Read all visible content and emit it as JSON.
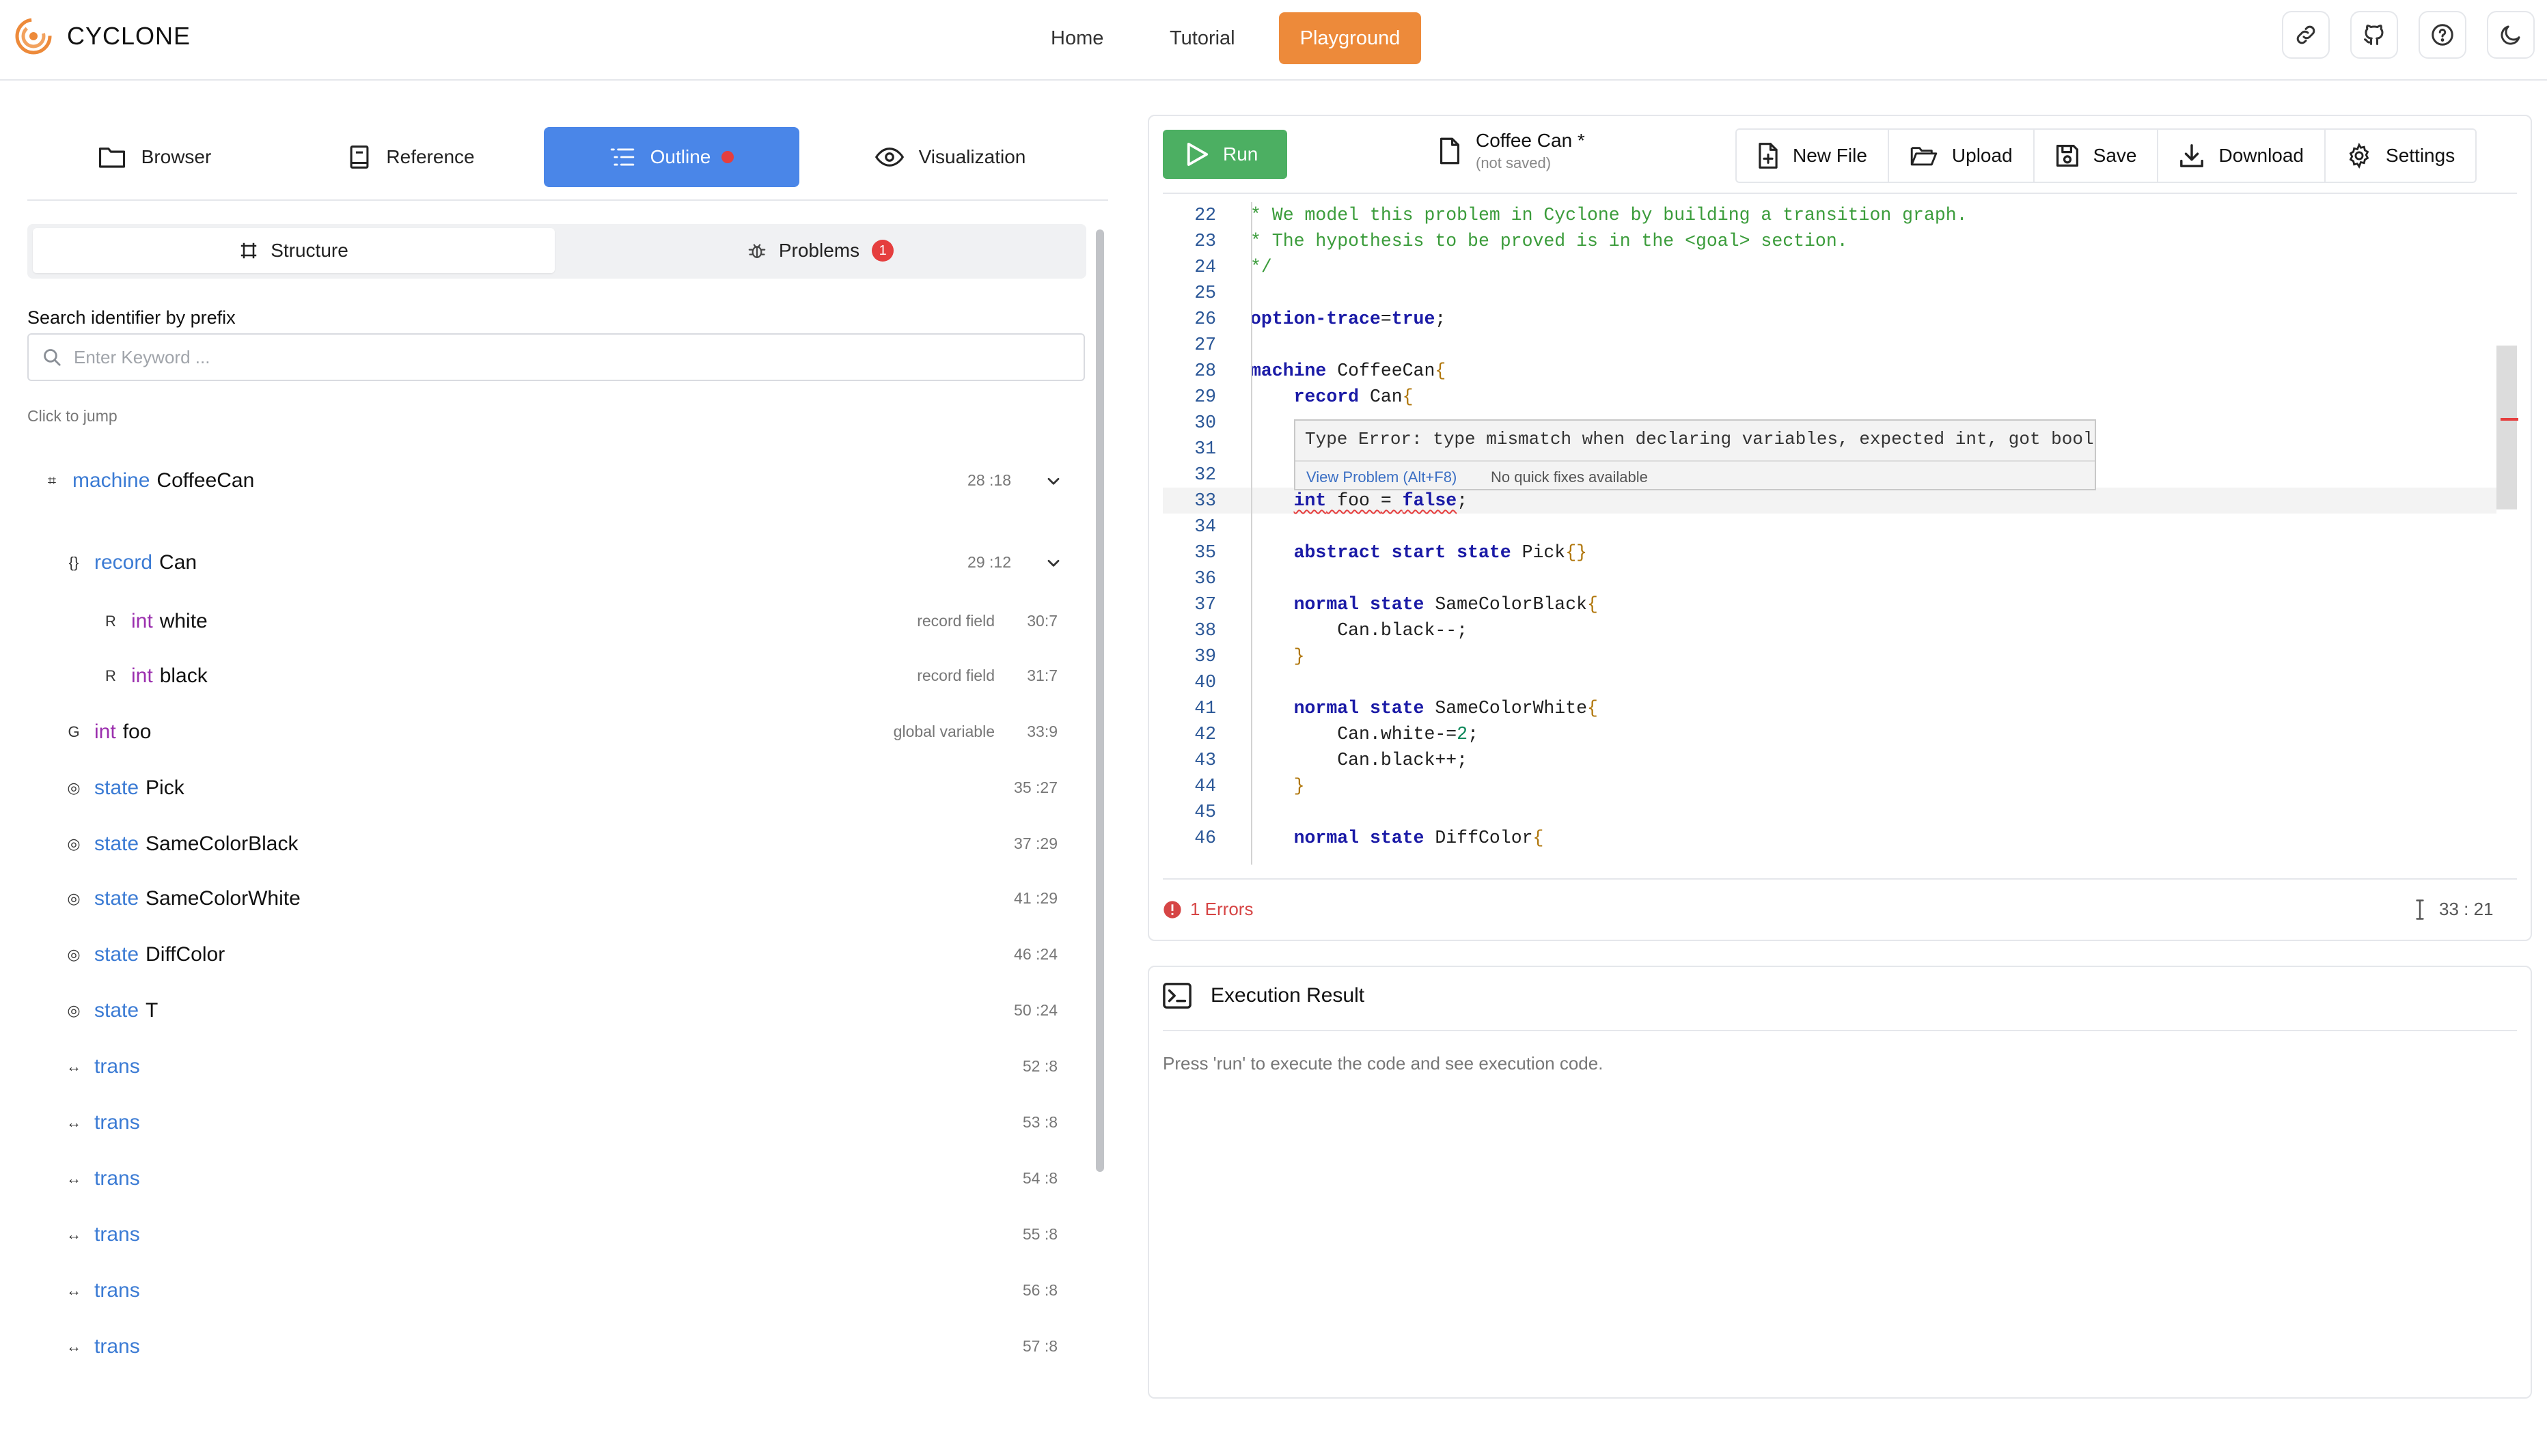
{
  "header": {
    "brand": "CYCLONE",
    "nav": [
      "Home",
      "Tutorial",
      "Playground"
    ],
    "icons": [
      "link-icon",
      "github-icon",
      "help-icon",
      "moon-icon"
    ]
  },
  "colors": {
    "accent": "#ed8a3a",
    "tab_active": "#4a86e8",
    "run": "#4caf62",
    "error": "#e53e3e"
  },
  "left": {
    "tabs": [
      "Browser",
      "Reference",
      "Outline",
      "Visualization"
    ],
    "active_tab": "Outline",
    "subtabs": {
      "structure": "Structure",
      "problems": "Problems",
      "problems_count": "1"
    },
    "search": {
      "label": "Search identifier by prefix",
      "placeholder": "Enter Keyword ..."
    },
    "hint": "Click to jump",
    "outline": [
      {
        "icon": "⌗",
        "kw": "machine",
        "name": "CoffeeCan",
        "kind": "",
        "pos": "28 :18",
        "expand": true
      },
      {
        "icon": "{}",
        "kw": "record",
        "name": "Can",
        "kind": "",
        "pos": "29 :12",
        "expand": true
      },
      {
        "icon": "R",
        "kw": "int",
        "name": "white",
        "kind": "record field",
        "pos": "30:7"
      },
      {
        "icon": "R",
        "kw": "int",
        "name": "black",
        "kind": "record field",
        "pos": "31:7"
      },
      {
        "icon": "G",
        "kw": "int",
        "name": "foo",
        "kind": "global variable",
        "pos": "33:9"
      },
      {
        "icon": "◎",
        "kw": "state",
        "name": "Pick",
        "kind": "",
        "pos": "35 :27"
      },
      {
        "icon": "◎",
        "kw": "state",
        "name": "SameColorBlack",
        "kind": "",
        "pos": "37 :29"
      },
      {
        "icon": "◎",
        "kw": "state",
        "name": "SameColorWhite",
        "kind": "",
        "pos": "41 :29"
      },
      {
        "icon": "◎",
        "kw": "state",
        "name": "DiffColor",
        "kind": "",
        "pos": "46 :24"
      },
      {
        "icon": "◎",
        "kw": "state",
        "name": "T",
        "kind": "",
        "pos": "50 :24"
      },
      {
        "icon": "↔",
        "kw": "trans",
        "name": "",
        "kind": "",
        "pos": "52 :8"
      },
      {
        "icon": "↔",
        "kw": "trans",
        "name": "",
        "kind": "",
        "pos": "53 :8"
      },
      {
        "icon": "↔",
        "kw": "trans",
        "name": "",
        "kind": "",
        "pos": "54 :8"
      },
      {
        "icon": "↔",
        "kw": "trans",
        "name": "",
        "kind": "",
        "pos": "55 :8"
      },
      {
        "icon": "↔",
        "kw": "trans",
        "name": "",
        "kind": "",
        "pos": "56 :8"
      },
      {
        "icon": "↔",
        "kw": "trans",
        "name": "",
        "kind": "",
        "pos": "57 :8"
      }
    ]
  },
  "editor": {
    "run": "Run",
    "file_name": "Coffee Can *",
    "file_status": "(not saved)",
    "toolbar": [
      "New File",
      "Upload",
      "Save",
      "Download",
      "Settings"
    ],
    "code": [
      {
        "n": "22",
        "t": [
          [
            "c-com",
            "* We model this problem in Cyclone by building a transition graph."
          ]
        ]
      },
      {
        "n": "23",
        "t": [
          [
            "c-com",
            "* The hypothesis to be proved is in the <goal> section."
          ]
        ]
      },
      {
        "n": "24",
        "t": [
          [
            "c-com",
            "*/"
          ]
        ]
      },
      {
        "n": "25",
        "t": []
      },
      {
        "n": "26",
        "t": [
          [
            "c-kw",
            "option-trace"
          ],
          [
            "c-op",
            "="
          ],
          [
            "c-kw",
            "true"
          ],
          [
            "c-op",
            ";"
          ]
        ]
      },
      {
        "n": "27",
        "t": []
      },
      {
        "n": "28",
        "t": [
          [
            "c-kw",
            "machine"
          ],
          [
            "c-id",
            " CoffeeCan"
          ],
          [
            "c-br",
            "{"
          ]
        ]
      },
      {
        "n": "29",
        "t": [
          [
            "c-id",
            "    "
          ],
          [
            "c-kw",
            "record"
          ],
          [
            "c-id",
            " Can"
          ],
          [
            "c-br",
            "{"
          ]
        ]
      },
      {
        "n": "30",
        "t": []
      },
      {
        "n": "31",
        "t": []
      },
      {
        "n": "32",
        "t": []
      },
      {
        "n": "33",
        "t": [
          [
            "c-id",
            "    "
          ],
          [
            "c-kw c-err",
            "int"
          ],
          [
            "c-id c-err",
            " foo "
          ],
          [
            "c-op c-err",
            "= "
          ],
          [
            "c-kw c-err",
            "false"
          ],
          [
            "c-op",
            ";"
          ]
        ],
        "current": true
      },
      {
        "n": "34",
        "t": []
      },
      {
        "n": "35",
        "t": [
          [
            "c-id",
            "    "
          ],
          [
            "c-kw",
            "abstract start state"
          ],
          [
            "c-id",
            " Pick"
          ],
          [
            "c-br",
            "{}"
          ]
        ]
      },
      {
        "n": "36",
        "t": []
      },
      {
        "n": "37",
        "t": [
          [
            "c-id",
            "    "
          ],
          [
            "c-kw",
            "normal state"
          ],
          [
            "c-id",
            " SameColorBlack"
          ],
          [
            "c-br",
            "{"
          ]
        ]
      },
      {
        "n": "38",
        "t": [
          [
            "c-id",
            "        Can.black--;"
          ]
        ]
      },
      {
        "n": "39",
        "t": [
          [
            "c-id",
            "    "
          ],
          [
            "c-br",
            "}"
          ]
        ]
      },
      {
        "n": "40",
        "t": []
      },
      {
        "n": "41",
        "t": [
          [
            "c-id",
            "    "
          ],
          [
            "c-kw",
            "normal state"
          ],
          [
            "c-id",
            " SameColorWhite"
          ],
          [
            "c-br",
            "{"
          ]
        ]
      },
      {
        "n": "42",
        "t": [
          [
            "c-id",
            "        Can.white-="
          ],
          [
            "c-num",
            "2"
          ],
          [
            "c-op",
            ";"
          ]
        ]
      },
      {
        "n": "43",
        "t": [
          [
            "c-id",
            "        Can.black++;"
          ]
        ]
      },
      {
        "n": "44",
        "t": [
          [
            "c-id",
            "    "
          ],
          [
            "c-br",
            "}"
          ]
        ]
      },
      {
        "n": "45",
        "t": []
      },
      {
        "n": "46",
        "t": [
          [
            "c-id",
            "    "
          ],
          [
            "c-kw",
            "normal state"
          ],
          [
            "c-id",
            " DiffColor"
          ],
          [
            "c-br",
            "{"
          ]
        ]
      }
    ],
    "tooltip": {
      "message": "Type Error: type mismatch when declaring variables, expected int, got bool",
      "link": "View Problem (Alt+F8)",
      "nofix": "No quick fixes available"
    },
    "errors": "1 Errors",
    "cursor": "33 : 21"
  },
  "execution": {
    "title": "Execution Result",
    "message": "Press 'run' to execute the code and see execution code."
  }
}
